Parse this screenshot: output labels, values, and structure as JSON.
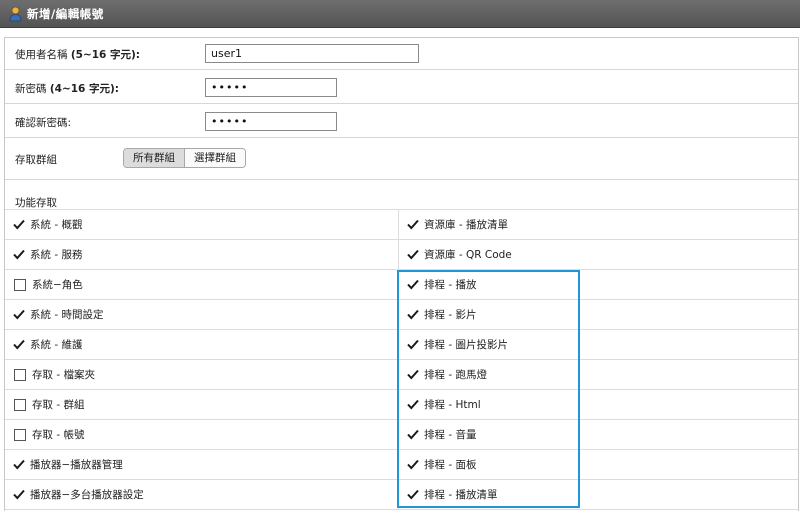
{
  "window": {
    "title": "新增/編輯帳號"
  },
  "form": {
    "username": {
      "label": "使用者名稱",
      "hint": "(5~16 字元):",
      "value": "user1"
    },
    "new_password": {
      "label": "新密碼",
      "hint": "(4~16 字元):",
      "value": "•••••"
    },
    "confirm_password": {
      "label": "確認新密碼:",
      "value": "•••••"
    },
    "access_group": {
      "label": "存取群組",
      "options": [
        "所有群組",
        "選擇群組"
      ],
      "selected": "所有群組"
    }
  },
  "permissions": {
    "heading": "功能存取",
    "left": [
      {
        "label": "系統 - 概觀",
        "checked": true
      },
      {
        "label": "系統 - 服務",
        "checked": true
      },
      {
        "label": "系統−角色",
        "checked": false
      },
      {
        "label": "系統 - 時間設定",
        "checked": true
      },
      {
        "label": "系統 - 維護",
        "checked": true
      },
      {
        "label": "存取 - 檔案夾",
        "checked": false
      },
      {
        "label": "存取 - 群組",
        "checked": false
      },
      {
        "label": "存取 - 帳號",
        "checked": false
      },
      {
        "label": "播放器−播放器管理",
        "checked": true
      },
      {
        "label": "播放器−多台播放器設定",
        "checked": true
      }
    ],
    "right": [
      {
        "label": "資源庫 - 播放清單",
        "checked": true
      },
      {
        "label": "資源庫 - QR Code",
        "checked": true
      },
      {
        "label": "排程 - 播放",
        "checked": true
      },
      {
        "label": "排程 - 影片",
        "checked": true
      },
      {
        "label": "排程 - 圖片投影片",
        "checked": true
      },
      {
        "label": "排程 - 跑馬燈",
        "checked": true
      },
      {
        "label": "排程 - Html",
        "checked": true
      },
      {
        "label": "排程 - 音量",
        "checked": true
      },
      {
        "label": "排程 - 面板",
        "checked": true
      },
      {
        "label": "排程 - 播放清單",
        "checked": true
      }
    ]
  },
  "colors": {
    "highlight": "#1e97d6",
    "titlebar": "#5f5f5f"
  }
}
